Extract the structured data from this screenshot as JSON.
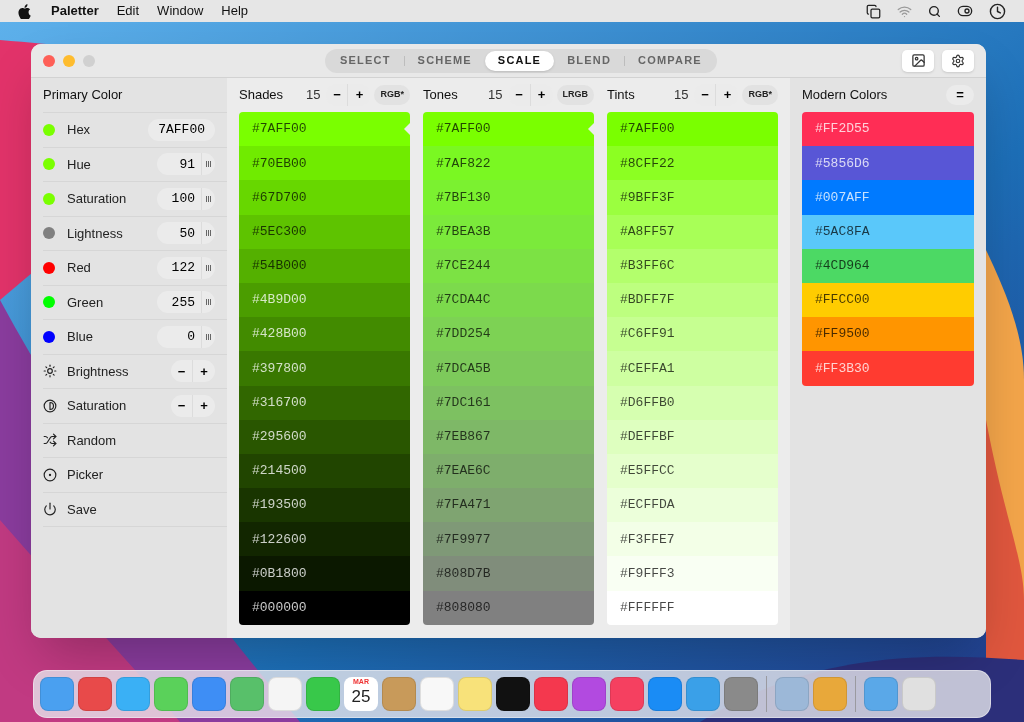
{
  "menu_bar": {
    "app_name": "Paletter",
    "menus": [
      "Edit",
      "Window",
      "Help"
    ]
  },
  "mode_tabs": [
    {
      "label": "SELECT",
      "selected": false
    },
    {
      "label": "SCHEME",
      "selected": false
    },
    {
      "label": "SCALE",
      "selected": true
    },
    {
      "label": "BLEND",
      "selected": false
    },
    {
      "label": "COMPARE",
      "selected": false
    }
  ],
  "sidebar": {
    "title": "Primary Color",
    "rows": [
      {
        "kind": "value",
        "label": "Hex",
        "value": "7AFF00",
        "color": "#7aff00"
      },
      {
        "kind": "stepper",
        "label": "Hue",
        "value": "91",
        "color": "#7aff00"
      },
      {
        "kind": "stepper",
        "label": "Saturation",
        "value": "100",
        "color": "#7aff00"
      },
      {
        "kind": "stepper",
        "label": "Lightness",
        "value": "50",
        "color": "#808080"
      },
      {
        "kind": "stepper",
        "label": "Red",
        "value": "122",
        "color": "#ff0000"
      },
      {
        "kind": "stepper",
        "label": "Green",
        "value": "255",
        "color": "#00ff00"
      },
      {
        "kind": "stepper",
        "label": "Blue",
        "value": "0",
        "color": "#0000ff"
      },
      {
        "kind": "brightness",
        "label": "Brightness",
        "minus": "−",
        "plus": "+"
      },
      {
        "kind": "contrast",
        "label": "Saturation",
        "minus": "−",
        "plus": "+"
      },
      {
        "kind": "random",
        "label": "Random"
      },
      {
        "kind": "picker",
        "label": "Picker"
      },
      {
        "kind": "save",
        "label": "Save"
      }
    ]
  },
  "scales": [
    {
      "title": "Shades",
      "count": "15",
      "minus": "−",
      "plus": "+",
      "mode": "RGB*",
      "swatches": [
        {
          "hex": "#7AFF00",
          "color": "#7aff00",
          "marked": true
        },
        {
          "hex": "#70EB00",
          "color": "#70eb00",
          "marked": false
        },
        {
          "hex": "#67D700",
          "color": "#67d700",
          "marked": false
        },
        {
          "hex": "#5EC300",
          "color": "#5ec300",
          "marked": false
        },
        {
          "hex": "#54B000",
          "color": "#54b000",
          "marked": false
        },
        {
          "hex": "#4B9D00",
          "color": "#4b9d00",
          "marked": false
        },
        {
          "hex": "#428B00",
          "color": "#428b00",
          "marked": false
        },
        {
          "hex": "#397800",
          "color": "#397800",
          "marked": false
        },
        {
          "hex": "#316700",
          "color": "#316700",
          "marked": false
        },
        {
          "hex": "#295600",
          "color": "#295600",
          "marked": false
        },
        {
          "hex": "#214500",
          "color": "#214500",
          "marked": false
        },
        {
          "hex": "#193500",
          "color": "#193500",
          "marked": false
        },
        {
          "hex": "#122600",
          "color": "#122600",
          "marked": false
        },
        {
          "hex": "#0B1800",
          "color": "#0b1800",
          "marked": false
        },
        {
          "hex": "#000000",
          "color": "#000000",
          "marked": false
        }
      ]
    },
    {
      "title": "Tones",
      "count": "15",
      "minus": "−",
      "plus": "+",
      "mode": "LRGB",
      "swatches": [
        {
          "hex": "#7AFF00",
          "color": "#7aff00",
          "marked": true
        },
        {
          "hex": "#7AF822",
          "color": "#7af822",
          "marked": false
        },
        {
          "hex": "#7BF130",
          "color": "#7bf130",
          "marked": false
        },
        {
          "hex": "#7BEA3B",
          "color": "#7bea3b",
          "marked": false
        },
        {
          "hex": "#7CE244",
          "color": "#7ce244",
          "marked": false
        },
        {
          "hex": "#7CDA4C",
          "color": "#7cda4c",
          "marked": false
        },
        {
          "hex": "#7DD254",
          "color": "#7dd254",
          "marked": false
        },
        {
          "hex": "#7DCA5B",
          "color": "#7dca5b",
          "marked": false
        },
        {
          "hex": "#7DC161",
          "color": "#7dc161",
          "marked": false
        },
        {
          "hex": "#7EB867",
          "color": "#7eb867",
          "marked": false
        },
        {
          "hex": "#7EAE6C",
          "color": "#7eae6c",
          "marked": false
        },
        {
          "hex": "#7FA471",
          "color": "#7fa471",
          "marked": false
        },
        {
          "hex": "#7F9977",
          "color": "#7f9977",
          "marked": false
        },
        {
          "hex": "#808D7B",
          "color": "#808d7b",
          "marked": false
        },
        {
          "hex": "#808080",
          "color": "#808080",
          "marked": false
        }
      ]
    },
    {
      "title": "Tints",
      "count": "15",
      "minus": "−",
      "plus": "+",
      "mode": "RGB*",
      "swatches": [
        {
          "hex": "#7AFF00",
          "color": "#7aff00",
          "marked": false
        },
        {
          "hex": "#8CFF22",
          "color": "#8cff22",
          "marked": false
        },
        {
          "hex": "#9BFF3F",
          "color": "#9bff3f",
          "marked": false
        },
        {
          "hex": "#A8FF57",
          "color": "#a8ff57",
          "marked": false
        },
        {
          "hex": "#B3FF6C",
          "color": "#b3ff6c",
          "marked": false
        },
        {
          "hex": "#BDFF7F",
          "color": "#bdff7f",
          "marked": false
        },
        {
          "hex": "#C6FF91",
          "color": "#c6ff91",
          "marked": false
        },
        {
          "hex": "#CEFFA1",
          "color": "#ceffa1",
          "marked": false
        },
        {
          "hex": "#D6FFB0",
          "color": "#d6ffb0",
          "marked": false
        },
        {
          "hex": "#DEFFBF",
          "color": "#deffbf",
          "marked": false
        },
        {
          "hex": "#E5FFCC",
          "color": "#e5ffcc",
          "marked": false
        },
        {
          "hex": "#ECFFDA",
          "color": "#ecffda",
          "marked": false
        },
        {
          "hex": "#F3FFE7",
          "color": "#f3ffe7",
          "marked": false
        },
        {
          "hex": "#F9FFF3",
          "color": "#f9fff3",
          "marked": false
        },
        {
          "hex": "#FFFFFF",
          "color": "#ffffff",
          "marked": false
        }
      ]
    }
  ],
  "modern_colors": {
    "title": "Modern Colors",
    "menu_glyph": "=",
    "swatches": [
      {
        "hex": "#FF2D55",
        "color": "#ff2d55"
      },
      {
        "hex": "#5856D6",
        "color": "#5856d6"
      },
      {
        "hex": "#007AFF",
        "color": "#007aff"
      },
      {
        "hex": "#5AC8FA",
        "color": "#5ac8fa"
      },
      {
        "hex": "#4CD964",
        "color": "#4cd964"
      },
      {
        "hex": "#FFCC00",
        "color": "#ffcc00"
      },
      {
        "hex": "#FF9500",
        "color": "#ff9500"
      },
      {
        "hex": "#FF3B30",
        "color": "#ff3b30"
      }
    ]
  },
  "dock": {
    "calendar_month": "MAR",
    "calendar_day": "25"
  }
}
